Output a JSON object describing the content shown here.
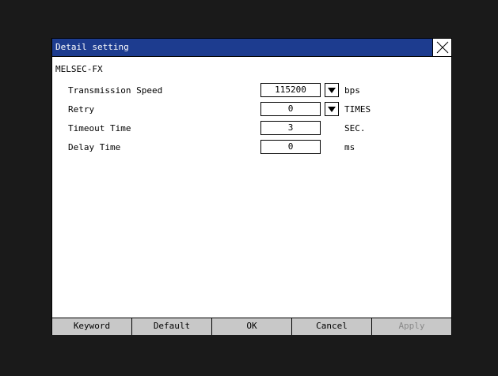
{
  "dialog": {
    "title": "Detail setting",
    "model": "MELSEC-FX"
  },
  "settings": [
    {
      "label": "Transmission Speed",
      "value": "115200",
      "unit": "bps",
      "dropdown": true
    },
    {
      "label": "Retry",
      "value": "0",
      "unit": "TIMES",
      "dropdown": true
    },
    {
      "label": "Timeout Time",
      "value": "3",
      "unit": "SEC.",
      "dropdown": false
    },
    {
      "label": "Delay Time",
      "value": "0",
      "unit": "ms",
      "dropdown": false
    }
  ],
  "buttons": {
    "keyword": "Keyword",
    "default": "Default",
    "ok": "OK",
    "cancel": "Cancel",
    "apply": "Apply"
  },
  "colors": {
    "titlebar": "#1d3c8f",
    "button_bg": "#c8c8c8",
    "background": "#1a1a1a"
  },
  "icons": {
    "close": "close-icon",
    "dropdown": "dropdown-arrow-icon"
  }
}
